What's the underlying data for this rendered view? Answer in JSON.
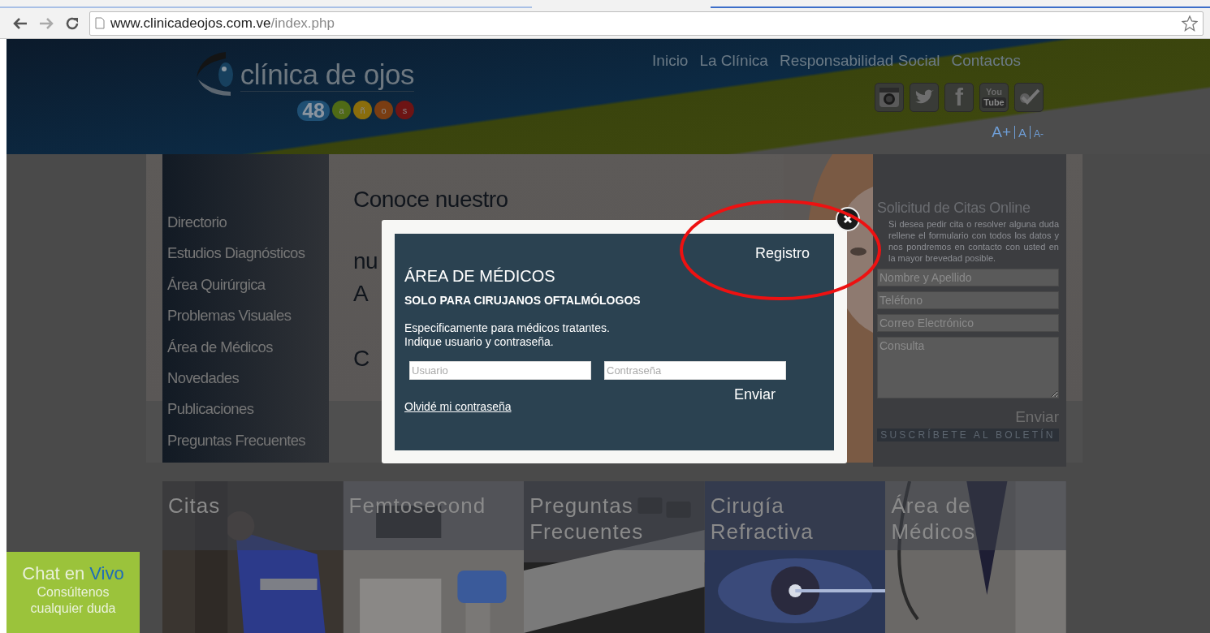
{
  "browser": {
    "url_host": "www.clinicadeojos.com.ve",
    "url_path": "/index.php"
  },
  "header": {
    "logo": {
      "name": "clínica de ojos",
      "letters": [
        {
          "kind": "number",
          "text": "48",
          "color": "#1f4f73"
        },
        {
          "text": "a",
          "color": "#4f6a16"
        },
        {
          "text": "ñ",
          "color": "#8a6d0c"
        },
        {
          "text": "o",
          "color": "#7a3d12"
        },
        {
          "text": "s",
          "color": "#6d1414"
        }
      ]
    },
    "nav": [
      "Inicio",
      "La Clínica",
      "Responsabilidad Social",
      "Contactos"
    ],
    "social": [
      {
        "kind": "camera"
      },
      {
        "kind": "bird"
      },
      {
        "kind": "letter",
        "text": "f"
      },
      {
        "kind": "video",
        "top": "You",
        "bottom": "Tube"
      },
      {
        "kind": "check"
      }
    ],
    "font_sizes": [
      "A+",
      "A",
      "A-"
    ]
  },
  "sidebar": {
    "items": [
      "Directorio",
      "Estudios Diagnósticos",
      "Área Quirúrgica",
      "Problemas Visuales",
      "Área de Médicos",
      "Novedades",
      "Publicaciones",
      "Preguntas Frecuentes"
    ]
  },
  "hero": {
    "lines": [
      "Conoce nuestro",
      "nu",
      "A",
      "C"
    ]
  },
  "appointment_form": {
    "title": "Solicitud de Citas Online",
    "text": "Si desea pedir cita o resolver alguna duda rellene el formulario con todos los datos y nos pondremos en contacto con usted en la mayor brevedad posible.",
    "fields": [
      {
        "kind": "input",
        "placeholder": "Nombre y Apellido"
      },
      {
        "kind": "input",
        "placeholder": "Teléfono"
      },
      {
        "kind": "input",
        "placeholder": "Correo Electrónico"
      },
      {
        "kind": "textarea",
        "placeholder": "Consulta"
      }
    ],
    "submit": "Enviar",
    "newsletter": "SUSCRÍBETE AL BOLETÍN"
  },
  "tiles": [
    {
      "title_lines": [
        "Citas"
      ]
    },
    {
      "title_lines": [
        "Femtosecond"
      ]
    },
    {
      "title_lines": [
        "Preguntas",
        "Frecuentes"
      ]
    },
    {
      "title_lines": [
        "Cirugía",
        "Refractiva"
      ]
    },
    {
      "title_lines": [
        "Área de",
        "Médicos"
      ]
    }
  ],
  "chat": {
    "title": "Chat en",
    "title_accent": "Vivo",
    "subtitle": "Consúltenos cualquier duda"
  },
  "modal": {
    "register": "Registro",
    "title": "ÁREA DE MÉDICOS",
    "subtitle": "SOLO PARA CIRUJANOS OFTALMÓLOGOS",
    "description": "Especificamente para médicos tratantes.\nIndique usuario y contraseña.",
    "fields": [
      {
        "placeholder": "Usuario"
      },
      {
        "placeholder": "Contraseña"
      }
    ],
    "forgot": "Olvidé mi contraseña",
    "submit": "Enviar"
  }
}
